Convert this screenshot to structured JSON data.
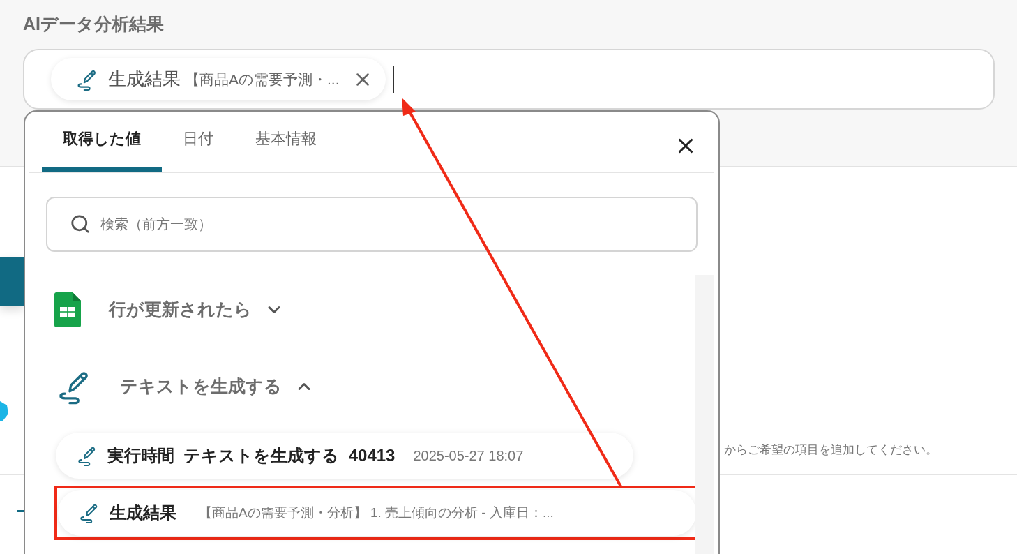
{
  "section_title": "AIデータ分析結果",
  "field": {
    "chip": {
      "label": "生成結果",
      "value": "【商品Aの需要予測・..."
    }
  },
  "backdrop": {
    "hint": "からご希望の項目を追加してください。"
  },
  "picker": {
    "tabs": [
      {
        "label": "取得した値",
        "selected": true
      },
      {
        "label": "日付",
        "selected": false
      },
      {
        "label": "基本情報",
        "selected": false
      }
    ],
    "search": {
      "placeholder": "検索（前方一致）"
    },
    "groups": [
      {
        "kind": "sheet",
        "label": "行が更新されたら",
        "expanded": false
      },
      {
        "kind": "pen",
        "label": "テキストを生成する",
        "expanded": true,
        "items": [
          {
            "label": "実行時間_テキストを生成する_40413",
            "value": "2025-05-27 18:07",
            "highlighted": false
          },
          {
            "label": "生成結果",
            "value": "【商品Aの需要予測・分析】 1. 売上傾向の分析 - 入庫日：...",
            "highlighted": true
          }
        ]
      }
    ]
  }
}
